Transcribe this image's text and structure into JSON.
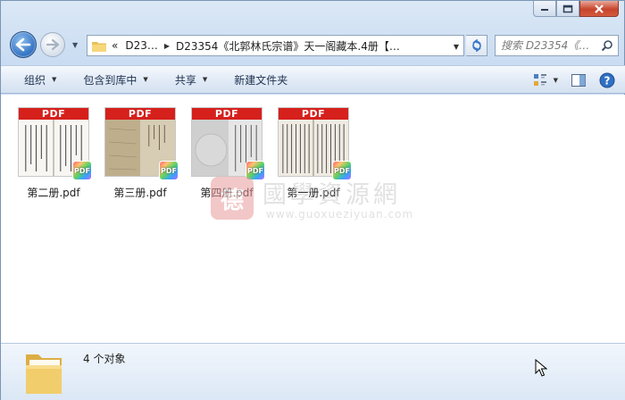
{
  "window": {
    "caption": {
      "minimize_icon": "minimize-icon",
      "maximize_icon": "maximize-icon",
      "close_icon": "close-icon"
    }
  },
  "navigation": {
    "back_icon": "arrow-left-icon",
    "forward_icon": "arrow-right-icon",
    "breadcrumb": {
      "overflow": "«",
      "items": [
        "D23…",
        "D23354《北郭林氏宗谱》天一阁藏本.4册【…"
      ]
    },
    "refresh_icon": "refresh-icon",
    "search": {
      "placeholder": "搜索 D23354《…",
      "icon": "search-icon"
    }
  },
  "toolbar": {
    "organize": "组织",
    "include_in_library": "包含到库中",
    "share": "共享",
    "new_folder": "新建文件夹",
    "icons": [
      "view-options-icon",
      "preview-pane-icon",
      "help-icon"
    ]
  },
  "files": [
    {
      "name": "第二册.pdf",
      "band": "PDF",
      "badge": "PDF"
    },
    {
      "name": "第三册.pdf",
      "band": "PDF",
      "badge": "PDF"
    },
    {
      "name": "第四册.pdf",
      "band": "PDF",
      "badge": "PDF"
    },
    {
      "name": "第一册.pdf",
      "band": "PDF",
      "badge": "PDF"
    }
  ],
  "watermark": {
    "seal": "德",
    "title": "國學資源網",
    "url": "www.guoxueziyuan.com"
  },
  "details": {
    "count": "4 个对象"
  },
  "colors": {
    "pdf_band": "#d6201c",
    "window_frame": "#c9dcf1",
    "command_bar": "#e1eaf6"
  }
}
